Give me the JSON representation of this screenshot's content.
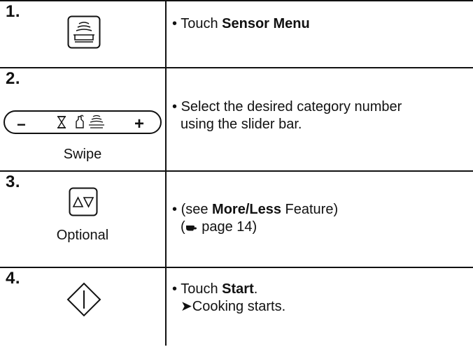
{
  "steps": [
    {
      "number": "1.",
      "icon": "sensor-menu-icon",
      "bullet": "•",
      "text_prefix": "Touch ",
      "text_bold": "Sensor Menu",
      "text_suffix": ""
    },
    {
      "number": "2.",
      "icon": "slider-bar-icon",
      "slider_minus": "−",
      "slider_plus": "+",
      "caption": "Swipe",
      "bullet": "•",
      "text_line1": "Select the desired category number",
      "text_line2": "using the slider bar."
    },
    {
      "number": "3.",
      "icon": "more-less-icon",
      "caption": "Optional",
      "bullet": "•",
      "text_prefix": "(see ",
      "text_bold": "More/Less",
      "text_suffix": " Feature)",
      "page_ref_open": "(",
      "page_ref_icon": "pointing-hand-icon",
      "page_ref_text": " page 14)"
    },
    {
      "number": "4.",
      "icon": "start-icon",
      "bullet": "•",
      "text_prefix": "Touch ",
      "text_bold": "Start",
      "text_suffix": ".",
      "result_arrow": "➤",
      "result_text": "Cooking starts."
    }
  ]
}
